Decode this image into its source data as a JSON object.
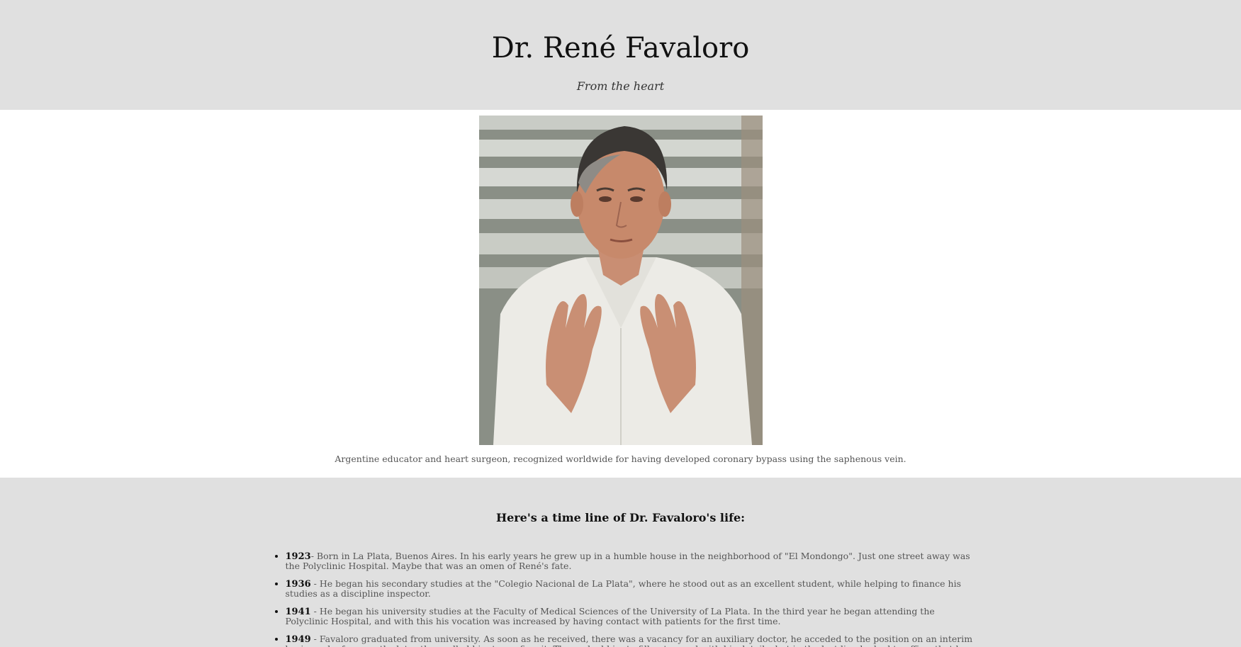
{
  "header": {
    "title": "Dr. René Favaloro",
    "tagline": "From the heart"
  },
  "figure": {
    "image_alt": "Portrait of Dr. René Favaloro in a white coat gesturing with both hands",
    "caption": "Argentine educator and heart surgeon, recognized worldwide for having developed coronary bypass using the saphenous vein."
  },
  "timeline": {
    "heading": "Here's a time line of Dr. Favaloro's life:",
    "items": [
      {
        "year": "1923",
        "text": "- Born in La Plata, Buenos Aires. In his early years he grew up in a humble house in the neighborhood of \"El Mondongo\". Just one street away was the Polyclinic Hospital. Maybe that was an omen of René's fate."
      },
      {
        "year": "1936",
        "text": " - He began his secondary studies at the \"Colegio Nacional de La Plata\", where he stood out as an excellent student, while helping to finance his studies as a discipline inspector."
      },
      {
        "year": "1941",
        "text": " - He began his university studies at the Faculty of Medical Sciences of the University of La Plata. In the third year he began attending the Polyclinic Hospital, and with this his vocation was increased by having contact with patients for the first time."
      },
      {
        "year": "1949",
        "text": " - Favaloro graduated from university. As soon as he received, there was a vacancy for an auxiliary doctor, he acceded to the position on an interim basis, and a few months later they called him to confirm it. They asked him to fill out a card with his details, but in the last line he had to affirm that he accepted the government's doctrine. Putting the"
      }
    ]
  }
}
